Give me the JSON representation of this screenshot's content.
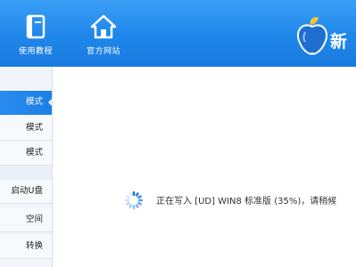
{
  "toolbar": {
    "tutorial_label": "使用教程",
    "website_label": "官方网站"
  },
  "brand": {
    "text": "新"
  },
  "sidebar": {
    "items": [
      {
        "label": "模式",
        "active": true
      },
      {
        "label": "模式",
        "active": false
      },
      {
        "label": "模式",
        "active": false
      },
      {
        "label": "启动U盘",
        "active": false
      },
      {
        "label": "空间",
        "active": false
      },
      {
        "label": "转换",
        "active": false
      }
    ]
  },
  "status": {
    "message": "正在写入 [UD] WIN8 标准版 (35%)，请稍候",
    "progress_percent": 35
  },
  "colors": {
    "header_blue": "#1f86ea",
    "active_item": "#2a8cf0",
    "brand_circle": "#1e6fcf",
    "leaf_yellow": "#f6c233"
  },
  "icons": {
    "tutorial": "book-icon",
    "website": "home-icon",
    "brand": "fruit-logo-icon",
    "loading": "spinner-icon"
  }
}
